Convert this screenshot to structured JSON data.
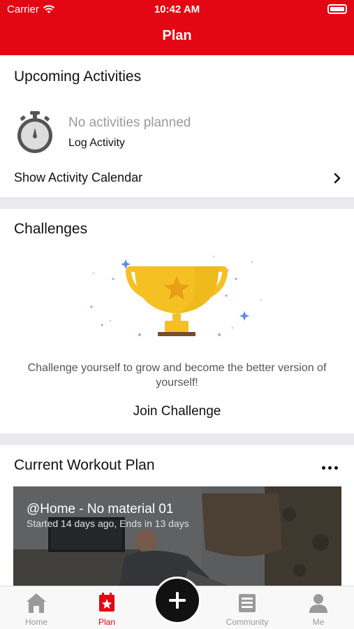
{
  "status_bar": {
    "carrier": "Carrier",
    "time": "10:42 AM"
  },
  "nav": {
    "title": "Plan"
  },
  "upcoming": {
    "title": "Upcoming Activities",
    "empty_text": "No activities planned",
    "log_activity": "Log Activity",
    "calendar_link": "Show Activity Calendar"
  },
  "challenges": {
    "title": "Challenges",
    "description": "Challenge yourself to grow and become the better version of yourself!",
    "join_label": "Join Challenge"
  },
  "workout": {
    "title": "Current Workout Plan",
    "plan_name": "@Home - No material 01",
    "plan_status": "Started 14 days ago, Ends in 13 days"
  },
  "tabbar": {
    "items": [
      {
        "label": "Home",
        "icon": "home-icon"
      },
      {
        "label": "Plan",
        "icon": "plan-icon",
        "active": true
      },
      {
        "label": "Community",
        "icon": "community-icon"
      },
      {
        "label": "Me",
        "icon": "me-icon"
      }
    ]
  },
  "colors": {
    "brand": "#e30613",
    "trophy": "#f5c024",
    "trophy_base": "#7a4d2a"
  }
}
